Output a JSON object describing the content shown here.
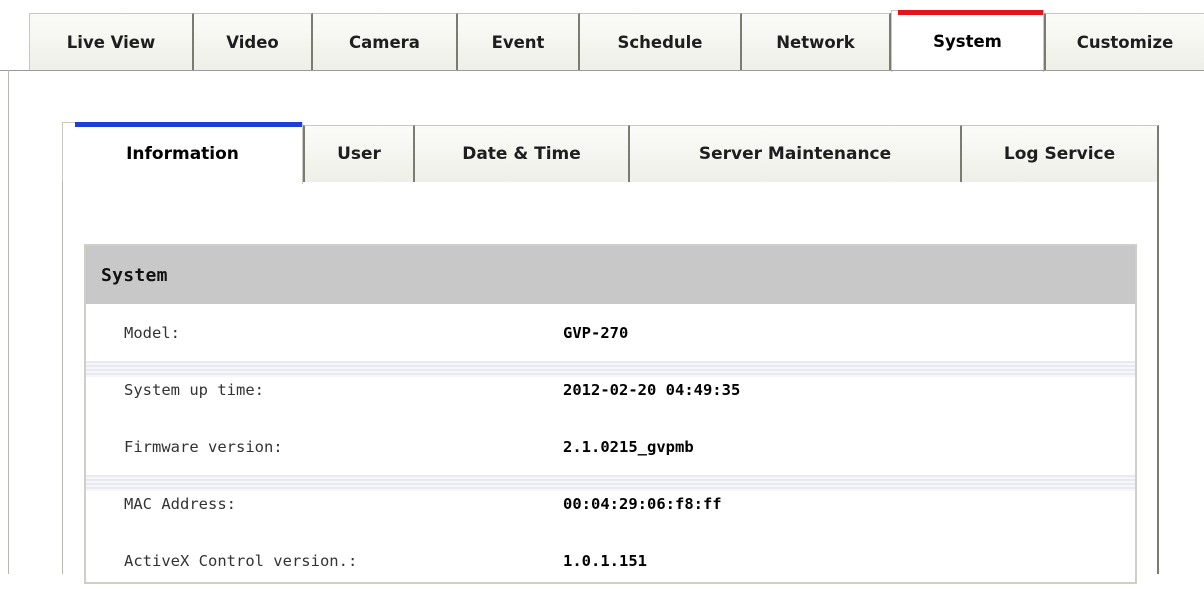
{
  "top_nav": {
    "tabs": [
      {
        "label": "Live View"
      },
      {
        "label": "Video"
      },
      {
        "label": "Camera"
      },
      {
        "label": "Event"
      },
      {
        "label": "Schedule"
      },
      {
        "label": "Network"
      },
      {
        "label": "System"
      },
      {
        "label": "Customize"
      }
    ],
    "active": "System",
    "active_color": "#e3151b"
  },
  "sub_nav": {
    "tabs": [
      {
        "label": "Information"
      },
      {
        "label": "User"
      },
      {
        "label": "Date & Time"
      },
      {
        "label": "Server Maintenance"
      },
      {
        "label": "Log Service"
      }
    ],
    "active": "Information",
    "active_color": "#1c3fd8"
  },
  "system_panel": {
    "title": "System",
    "rows": [
      {
        "label": "Model:",
        "value": "GVP-270"
      },
      {
        "label": "System up time:",
        "value": "2012-02-20 04:49:35"
      },
      {
        "label": "Firmware version:",
        "value": "2.1.0215_gvpmb"
      },
      {
        "label": "MAC Address:",
        "value": "00:04:29:06:f8:ff"
      },
      {
        "label": "ActiveX Control version.:",
        "value": "1.0.1.151"
      }
    ]
  }
}
